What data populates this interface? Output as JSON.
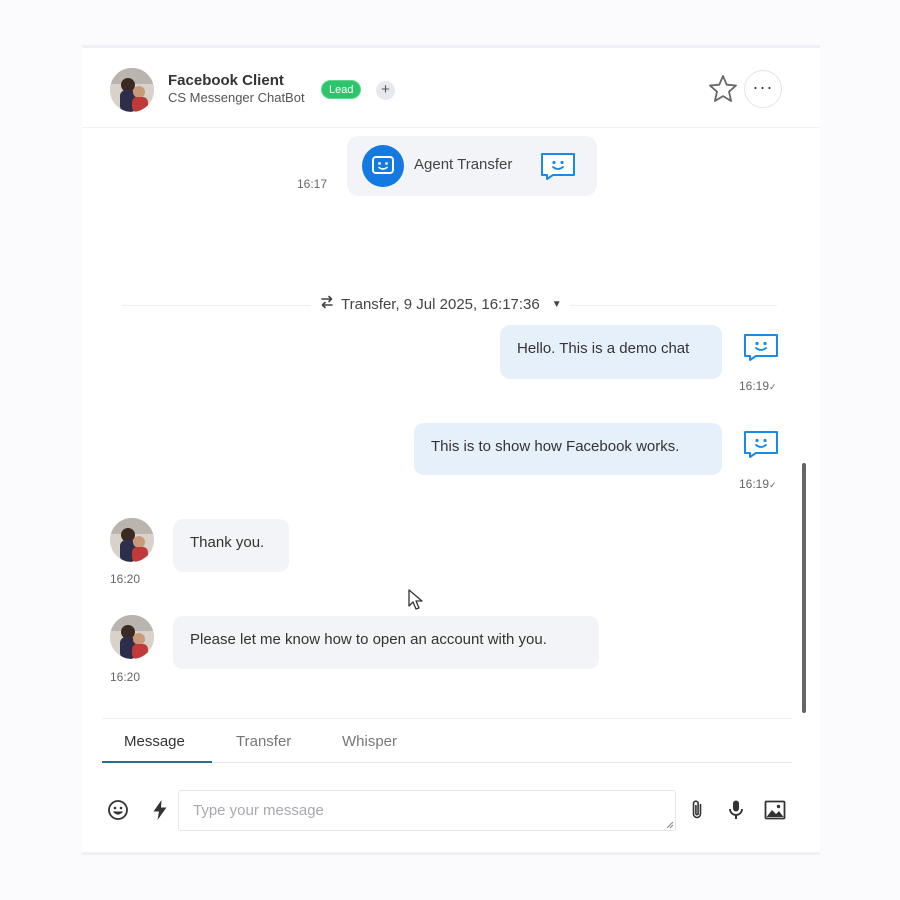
{
  "header": {
    "contact_name": "Facebook Client",
    "subtitle": "CS Messenger ChatBot",
    "badge": "Lead",
    "add_tag": "+",
    "more": "···",
    "icons": [
      "avatar",
      "add-tag-icon",
      "star-icon",
      "more-icon"
    ]
  },
  "transcript": {
    "agent_card": {
      "label": "Agent Transfer",
      "time": "16:17"
    },
    "divider": {
      "text": "Transfer, 9 Jul 2025, 16:17:36",
      "caret": "▼"
    },
    "messages": [
      {
        "direction": "outgoing",
        "text": "Hello. This is a demo chat",
        "time": "16:19",
        "status": "✓"
      },
      {
        "direction": "outgoing",
        "text": "This is to show how Facebook works.",
        "time": "16:19",
        "status": "✓"
      },
      {
        "direction": "incoming",
        "text": "Thank you.",
        "time": "16:20"
      },
      {
        "direction": "incoming",
        "text": "Please let me know how to open an account with you.",
        "time": "16:20"
      }
    ]
  },
  "composer": {
    "tabs": [
      {
        "label": "Message",
        "active": true
      },
      {
        "label": "Transfer",
        "active": false
      },
      {
        "label": "Whisper",
        "active": false
      }
    ],
    "placeholder": "Type your message",
    "value": "",
    "icons": [
      "emoji-icon",
      "bolt-icon",
      "paperclip-icon",
      "microphone-icon",
      "image-icon"
    ]
  },
  "colors": {
    "accent_blue": "#1479e0",
    "bot_icon_blue": "#1a8ae6",
    "outgoing_bubble": "#e6f0fb",
    "incoming_bubble": "#f3f4f7",
    "lead_green": "#2dc46b",
    "tab_underline": "#2a6f8d"
  }
}
